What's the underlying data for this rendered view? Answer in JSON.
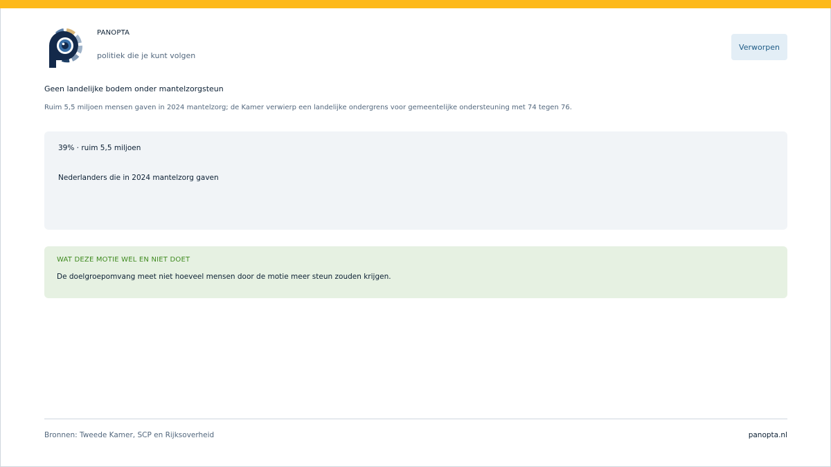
{
  "colors": {
    "accent": "#fdb91b",
    "navy": "#0b1f33",
    "muted": "#52677d",
    "badge_bg": "#e3eef6",
    "badge_text": "#1e5b86",
    "stat_bg": "#f1f4f7",
    "note_bg": "#e6f1e2",
    "note_heading": "#3f8a1f"
  },
  "header": {
    "logo_icon": "panopta-eye-p-logo",
    "brand_name": "PANOPTA",
    "tagline": "politiek die je kunt volgen",
    "status": "Verworpen"
  },
  "article": {
    "headline": "Geen landelijke bodem onder mantelzorgsteun",
    "lede": "Ruim 5,5 miljoen mensen gaven in 2024 mantelzorg; de Kamer verwierp een landelijke ondergrens voor gemeentelijke ondersteuning met 74 tegen 76."
  },
  "stat": {
    "value": "39% · ruim 5,5 miljoen",
    "label": "Nederlanders die in 2024 mantelzorg gaven"
  },
  "note": {
    "heading": "WAT DEZE MOTIE WEL EN NIET DOET",
    "body": "De doelgroepomvang meet niet hoeveel mensen door de motie meer steun zouden krijgen."
  },
  "footer": {
    "sources": "Bronnen: Tweede Kamer, SCP en Rijksoverheid",
    "site": "panopta.nl"
  }
}
